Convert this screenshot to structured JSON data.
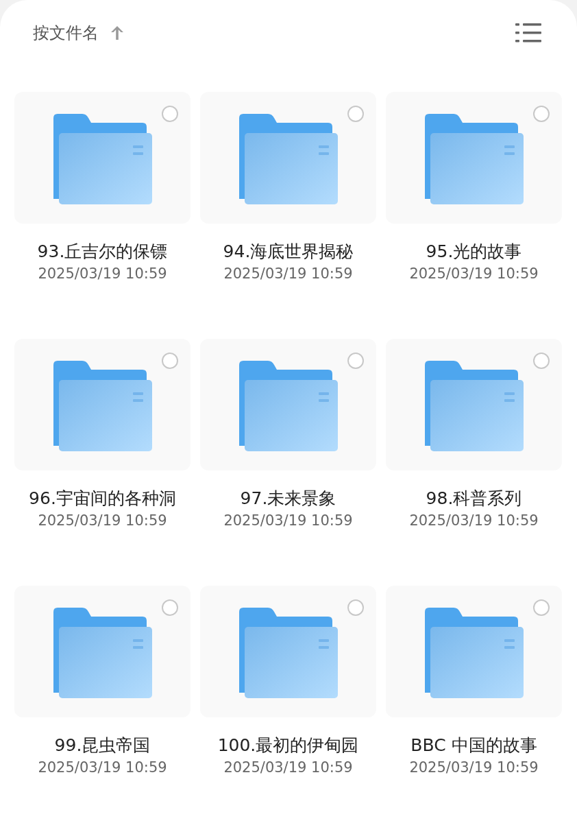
{
  "header": {
    "sort_label": "按文件名",
    "sort_ascending": true
  },
  "folders": [
    {
      "name": "93.丘吉尔的保镖",
      "date": "2025/03/19 10:59",
      "selected": false
    },
    {
      "name": "94.海底世界揭秘",
      "date": "2025/03/19 10:59",
      "selected": false
    },
    {
      "name": "95.光的故事",
      "date": "2025/03/19 10:59",
      "selected": false
    },
    {
      "name": "96.宇宙间的各种洞",
      "date": "2025/03/19 10:59",
      "selected": false
    },
    {
      "name": "97.未来景象",
      "date": "2025/03/19 10:59",
      "selected": false
    },
    {
      "name": "98.科普系列",
      "date": "2025/03/19 10:59",
      "selected": false
    },
    {
      "name": "99.昆虫帝国",
      "date": "2025/03/19 10:59",
      "selected": false
    },
    {
      "name": "100.最初的伊甸园",
      "date": "2025/03/19 10:59",
      "selected": false
    },
    {
      "name": "BBC 中国的故事",
      "date": "2025/03/19 10:59",
      "selected": false
    }
  ]
}
